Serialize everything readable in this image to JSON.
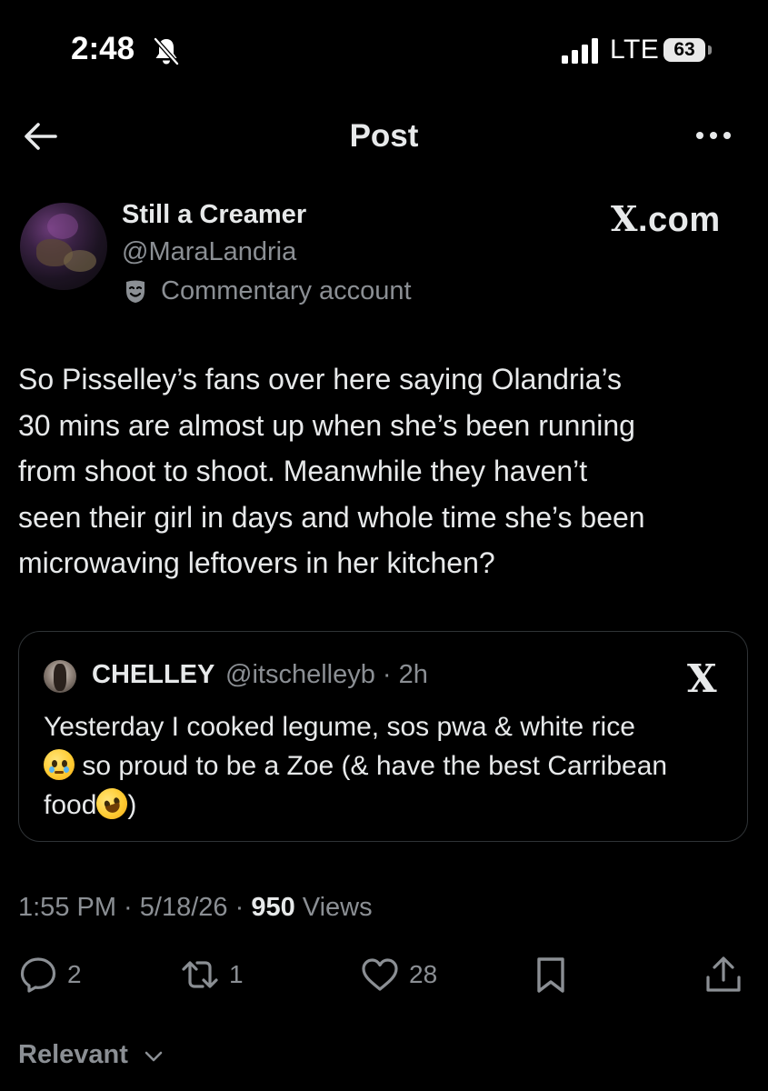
{
  "status_bar": {
    "time": "2:48",
    "network": "LTE",
    "battery": "63",
    "icons": [
      "bell-off-icon",
      "signal-icon",
      "battery-icon"
    ]
  },
  "header": {
    "title": "Post",
    "back_icon": "arrow-left-icon",
    "more_icon": "more-horizontal-icon"
  },
  "post": {
    "author": {
      "display_name": "Still a Creamer",
      "handle": "@MaraLandria",
      "label": "Commentary account",
      "label_icon": "theater-mask-icon"
    },
    "watermark": {
      "x": "X",
      "suffix": ".com"
    },
    "text_lines": [
      "So Pisselley’s fans over here saying Olandria’s",
      "30 mins are almost up when she’s been running",
      "from shoot to shoot. Meanwhile they haven’t",
      "seen their girl in days and whole time she’s been",
      "microwaving leftovers in her kitchen?"
    ],
    "quoted": {
      "display_name": "CHELLEY",
      "handle_time": "@itschelleyb · 2h",
      "x_logo": "X",
      "line1": "Yesterday I cooked legume, sos pwa & white rice",
      "line2_after_emoji": " so proud to be a Zoe (& have the best Carribean",
      "line3_before_emoji": "food",
      "line3_after_emoji": ")",
      "emojis": [
        "pleading-face-emoji",
        "rolling-on-floor-laughing-emoji"
      ]
    },
    "meta": {
      "time": "1:55 PM",
      "sep1": " · ",
      "date": "5/18/26",
      "sep2": " · ",
      "views_count": "950",
      "views_label": " Views"
    },
    "actions": {
      "replies": "2",
      "reposts": "1",
      "likes": "28",
      "icons": [
        "reply-icon",
        "repost-icon",
        "like-icon",
        "bookmark-icon",
        "share-icon"
      ]
    }
  },
  "sort": {
    "label": "Relevant",
    "icon": "chevron-down-icon"
  }
}
